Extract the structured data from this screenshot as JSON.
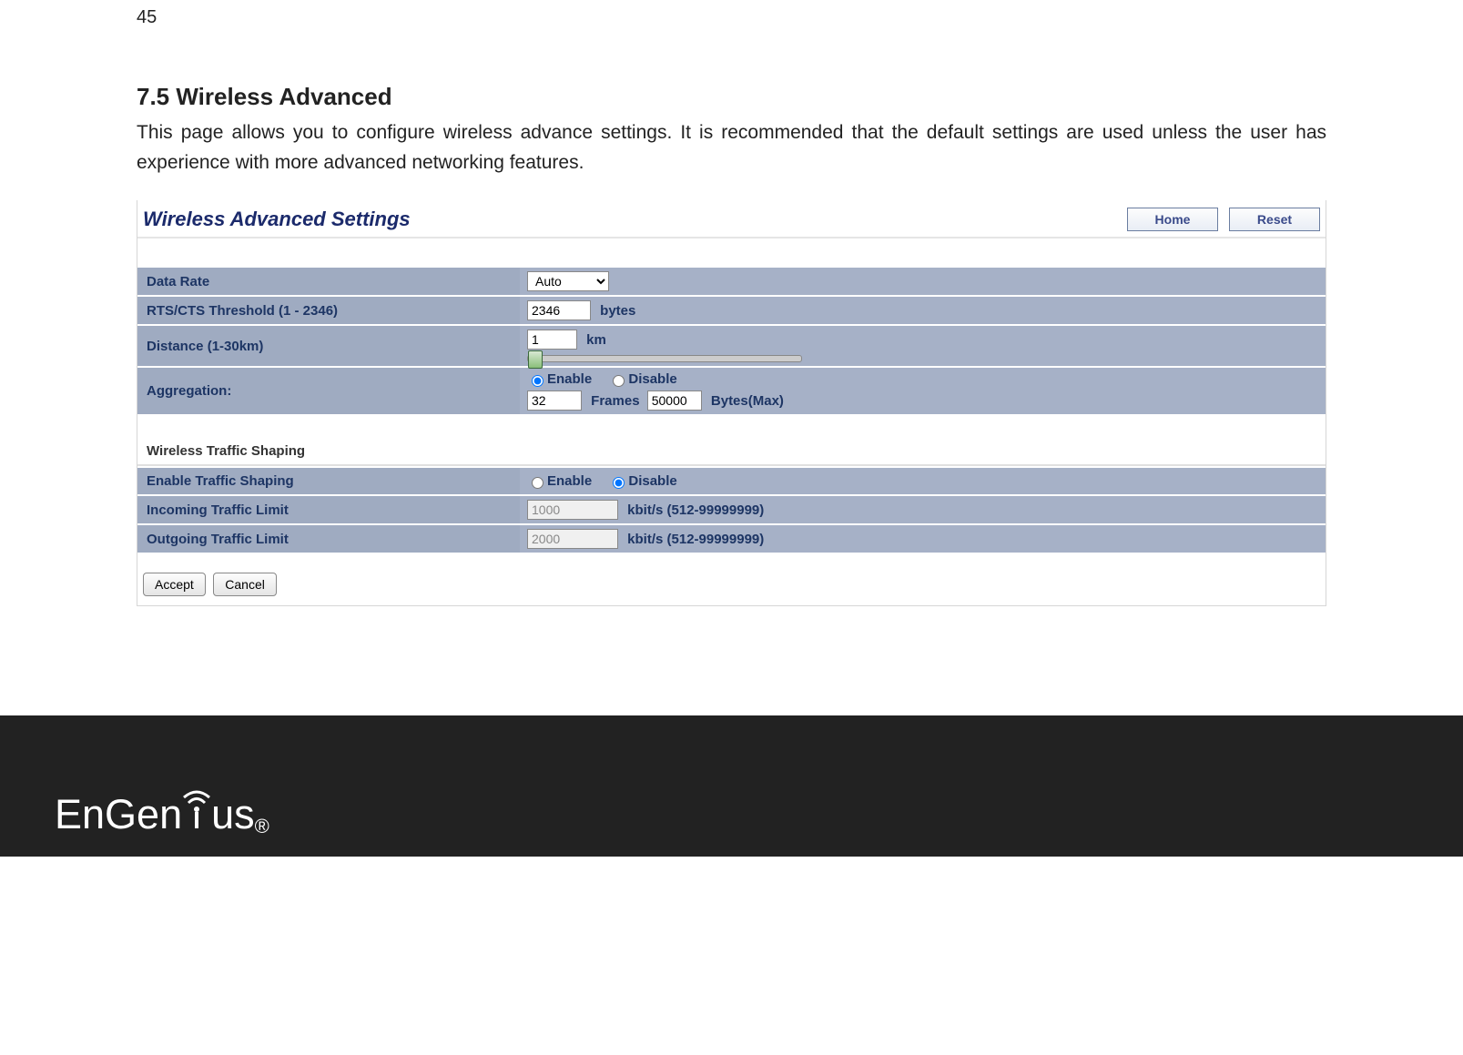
{
  "page": {
    "number": "45",
    "section_title": "7.5   Wireless Advanced",
    "intro": "This page allows you to configure wireless advance settings. It is recommended that the default settings are used unless the user has experience with more advanced networking features."
  },
  "ui": {
    "title": "Wireless Advanced Settings",
    "home": "Home",
    "reset": "Reset",
    "rows": {
      "data_rate": {
        "label": "Data Rate",
        "value": "Auto"
      },
      "rts": {
        "label": "RTS/CTS Threshold (1 - 2346)",
        "value": "2346",
        "unit": "bytes"
      },
      "distance": {
        "label": "Distance (1-30km)",
        "value": "1",
        "unit": "km"
      },
      "aggregation": {
        "label": "Aggregation:",
        "enable": "Enable",
        "disable": "Disable",
        "selected": "enable",
        "frames_value": "32",
        "frames_label": "Frames",
        "bytes_value": "50000",
        "bytes_label": "Bytes(Max)"
      }
    },
    "traffic": {
      "heading": "Wireless Traffic Shaping",
      "enable_row": {
        "label": "Enable Traffic Shaping",
        "enable": "Enable",
        "disable": "Disable",
        "selected": "disable"
      },
      "incoming": {
        "label": "Incoming Traffic Limit",
        "value": "1000",
        "unit": "kbit/s (512-99999999)"
      },
      "outgoing": {
        "label": "Outgoing Traffic Limit",
        "value": "2000",
        "unit": "kbit/s (512-99999999)"
      }
    },
    "actions": {
      "accept": "Accept",
      "cancel": "Cancel"
    }
  },
  "footer": {
    "brand_left": "EnGen",
    "brand_right": "us",
    "reg": "®"
  }
}
